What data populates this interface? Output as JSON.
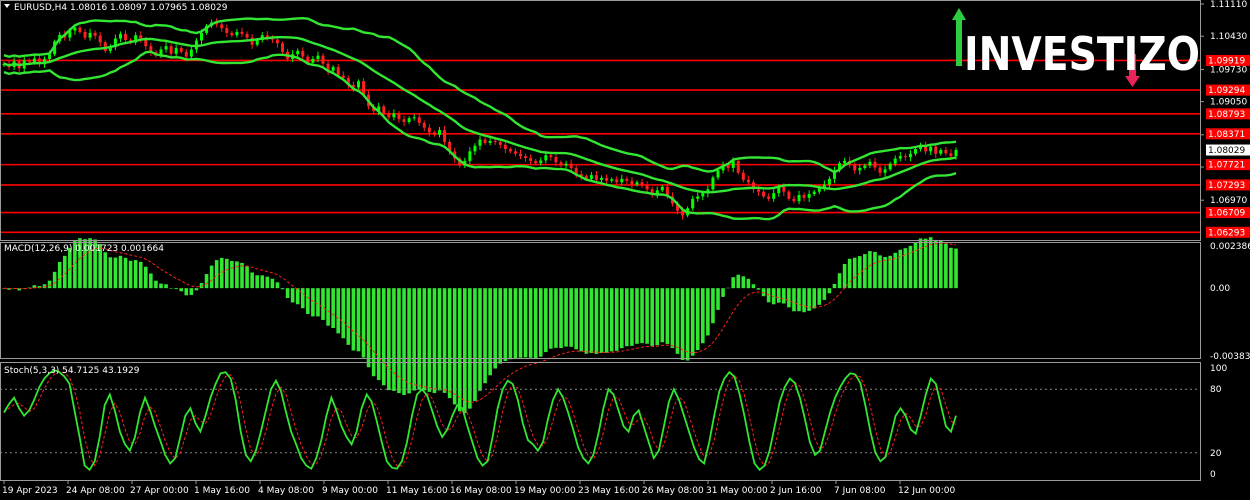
{
  "header": {
    "symbol_info": "EURUSD,H4  1.08016 1.08097 1.07965 1.08029",
    "macd_label": "MACD(12,26,9) 0.001723 0.001664",
    "stoch_label": "Stoch(5,3,3) 54.7125 43.1929"
  },
  "logo": {
    "text": "INVESTIZO",
    "colors": {
      "up": "#2ecc40",
      "down": "#e8245a"
    }
  },
  "colors": {
    "background": "#000000",
    "candle_up": "#00ff00",
    "candle_down": "#ff2020",
    "bands": "#32e632",
    "level_line": "#ff0000",
    "macd_hist": "#32e632",
    "macd_signal": "#ff2020",
    "stoch_main": "#32e632",
    "stoch_signal": "#ff2020",
    "price_tag": "#ffffff"
  },
  "chart_data": [
    {
      "type": "candlestick",
      "title": "EURUSD,H4",
      "ylim": [
        1.06215,
        1.1111
      ],
      "y_ticks": [
        "1.11110",
        "1.10430",
        "1.09730",
        "1.09050",
        "1.08350",
        "1.07670",
        "1.06970"
      ],
      "x_ticks": [
        "19 Apr 2023",
        "24 Apr 08:00",
        "27 Apr 00:00",
        "1 May 16:00",
        "4 May 08:00",
        "9 May 00:00",
        "11 May 16:00",
        "16 May 08:00",
        "19 May 00:00",
        "23 May 16:00",
        "26 May 08:00",
        "31 May 00:00",
        "2 Jun 16:00",
        "7 Jun 08:00",
        "12 Jun 00:00"
      ],
      "closes": [
        1.0985,
        1.0978,
        1.099,
        1.0975,
        1.0992,
        1.0988,
        1.0996,
        1.0984,
        1.0995,
        1.1005,
        1.1032,
        1.1046,
        1.104,
        1.1055,
        1.1061,
        1.1052,
        1.104,
        1.105,
        1.1044,
        1.103,
        1.1012,
        1.102,
        1.1038,
        1.1048,
        1.1035,
        1.103,
        1.1045,
        1.1036,
        1.1022,
        1.101,
        1.1002,
        1.1015,
        1.1022,
        1.1006,
        1.1018,
        1.101,
        1.1,
        1.1015,
        1.1034,
        1.105,
        1.1065,
        1.1072,
        1.1068,
        1.106,
        1.105,
        1.1045,
        1.1052,
        1.1048,
        1.104,
        1.1025,
        1.1035,
        1.1045,
        1.104,
        1.1036,
        1.1028,
        1.101,
        1.0995,
        1.1005,
        1.1012,
        1.1,
        1.0987,
        1.0995,
        1.1002,
        1.0985,
        1.097,
        1.0978,
        1.096,
        1.0955,
        1.094,
        1.0935,
        1.0948,
        1.092,
        1.0895,
        1.0885,
        1.0895,
        1.088,
        1.0872,
        1.088,
        1.0868,
        1.0862,
        1.087,
        1.0872,
        1.086,
        1.085,
        1.084,
        1.0835,
        1.0845,
        1.082,
        1.08,
        1.0785,
        1.077,
        1.078,
        1.08,
        1.0812,
        1.0825,
        1.0818,
        1.0822,
        1.082,
        1.0814,
        1.0805,
        1.08,
        1.0795,
        1.079,
        1.0786,
        1.078,
        1.0775,
        1.0781,
        1.0792,
        1.0788,
        1.0777,
        1.077,
        1.0774,
        1.0765,
        1.0752,
        1.0748,
        1.0742,
        1.075,
        1.074,
        1.0744,
        1.0738,
        1.0741,
        1.0735,
        1.0742,
        1.0738,
        1.073,
        1.0735,
        1.0728,
        1.072,
        1.071,
        1.0718,
        1.0725,
        1.0705,
        1.069,
        1.0675,
        1.0665,
        1.068,
        1.07,
        1.0705,
        1.0712,
        1.072,
        1.0745,
        1.076,
        1.077,
        1.0765,
        1.078,
        1.0755,
        1.074,
        1.0735,
        1.072,
        1.0715,
        1.0705,
        1.07,
        1.0712,
        1.0725,
        1.0715,
        1.07,
        1.0695,
        1.0708,
        1.0702,
        1.071,
        1.0715,
        1.0722,
        1.073,
        1.0742,
        1.076,
        1.0775,
        1.078,
        1.0772,
        1.076,
        1.0765,
        1.077,
        1.0778,
        1.0766,
        1.0755,
        1.0762,
        1.0774,
        1.0785,
        1.079,
        1.0788,
        1.0795,
        1.0805,
        1.0812,
        1.08,
        1.081,
        1.0795,
        1.0803,
        1.0796,
        1.079,
        1.0803
      ],
      "bands_period": 20,
      "bands_deviation": 2,
      "price_levels": [
        "1.09919",
        "1.09294",
        "1.08793",
        "1.08371",
        "1.07721",
        "1.07293",
        "1.06709",
        "1.06293"
      ],
      "current_price": "1.08029"
    },
    {
      "type": "histogram",
      "title": "MACD(12,26,9)",
      "ylim": [
        -0.003839,
        0.002386
      ],
      "y_ticks": [
        "0.002386",
        "0.00",
        "-0.003839"
      ]
    },
    {
      "type": "line",
      "title": "Stoch(5,3,3)",
      "ylim": [
        0,
        100
      ],
      "y_ticks": [
        "100",
        "80",
        "20",
        "0"
      ],
      "levels": [
        80,
        20
      ],
      "values": [
        58,
        66,
        72,
        62,
        55,
        60,
        70,
        82,
        90,
        95,
        98,
        96,
        92,
        85,
        60,
        35,
        8,
        4,
        12,
        35,
        65,
        75,
        60,
        40,
        28,
        22,
        35,
        58,
        72,
        60,
        45,
        32,
        18,
        10,
        15,
        35,
        55,
        62,
        48,
        40,
        55,
        72,
        85,
        95,
        96,
        90,
        70,
        40,
        18,
        12,
        22,
        40,
        60,
        80,
        88,
        78,
        58,
        40,
        28,
        15,
        8,
        5,
        15,
        32,
        55,
        72,
        60,
        45,
        35,
        28,
        40,
        62,
        75,
        68,
        50,
        30,
        12,
        6,
        5,
        12,
        30,
        55,
        75,
        80,
        74,
        60,
        45,
        35,
        42,
        55,
        65,
        62,
        45,
        30,
        15,
        8,
        12,
        35,
        62,
        80,
        88,
        85,
        70,
        48,
        32,
        28,
        22,
        30,
        52,
        70,
        80,
        72,
        58,
        42,
        25,
        15,
        10,
        18,
        38,
        62,
        80,
        75,
        60,
        45,
        40,
        55,
        60,
        45,
        30,
        15,
        22,
        45,
        68,
        80,
        70,
        55,
        40,
        25,
        14,
        10,
        30,
        55,
        78,
        90,
        96,
        92,
        76,
        55,
        30,
        10,
        4,
        8,
        22,
        45,
        68,
        82,
        90,
        86,
        72,
        52,
        30,
        18,
        22,
        40,
        58,
        72,
        82,
        90,
        95,
        94,
        86,
        65,
        40,
        20,
        12,
        16,
        35,
        55,
        62,
        55,
        42,
        38,
        55,
        75,
        90,
        85,
        65,
        45,
        40,
        55
      ]
    }
  ]
}
